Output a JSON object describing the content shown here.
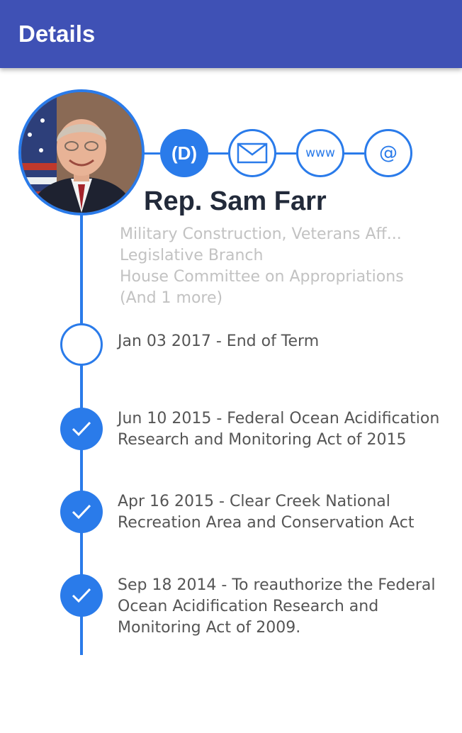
{
  "appbar": {
    "title": "Details"
  },
  "profile": {
    "name": "Rep. Sam Farr",
    "party_label": "(D)",
    "website_label": "www",
    "social_label": "@",
    "committees": [
      "Military Construction, Veterans Aff...",
      "Legislative Branch",
      "House Committee on Appropriations",
      "(And 1 more)"
    ]
  },
  "timeline": [
    {
      "text": "Jan 03 2017 - End of Term",
      "completed": false
    },
    {
      "text": "Jun 10 2015 - Federal Ocean Acidification Research and Monitoring Act of 2015",
      "completed": true
    },
    {
      "text": "Apr 16 2015 - Clear Creek National Recreation Area and Conservation Act",
      "completed": true
    },
    {
      "text": "Sep 18 2014 - To reauthorize the Federal Ocean Acidification Research and Monitoring Act of 2009.",
      "completed": true
    }
  ],
  "icons": {
    "email": "envelope-icon",
    "completed": "checkmark-icon"
  },
  "colors": {
    "appbar": "#3f51b5",
    "accent": "#2a7bea",
    "name_text": "#222a3a",
    "committee_text": "#c2c2c2",
    "event_text": "#555555"
  }
}
